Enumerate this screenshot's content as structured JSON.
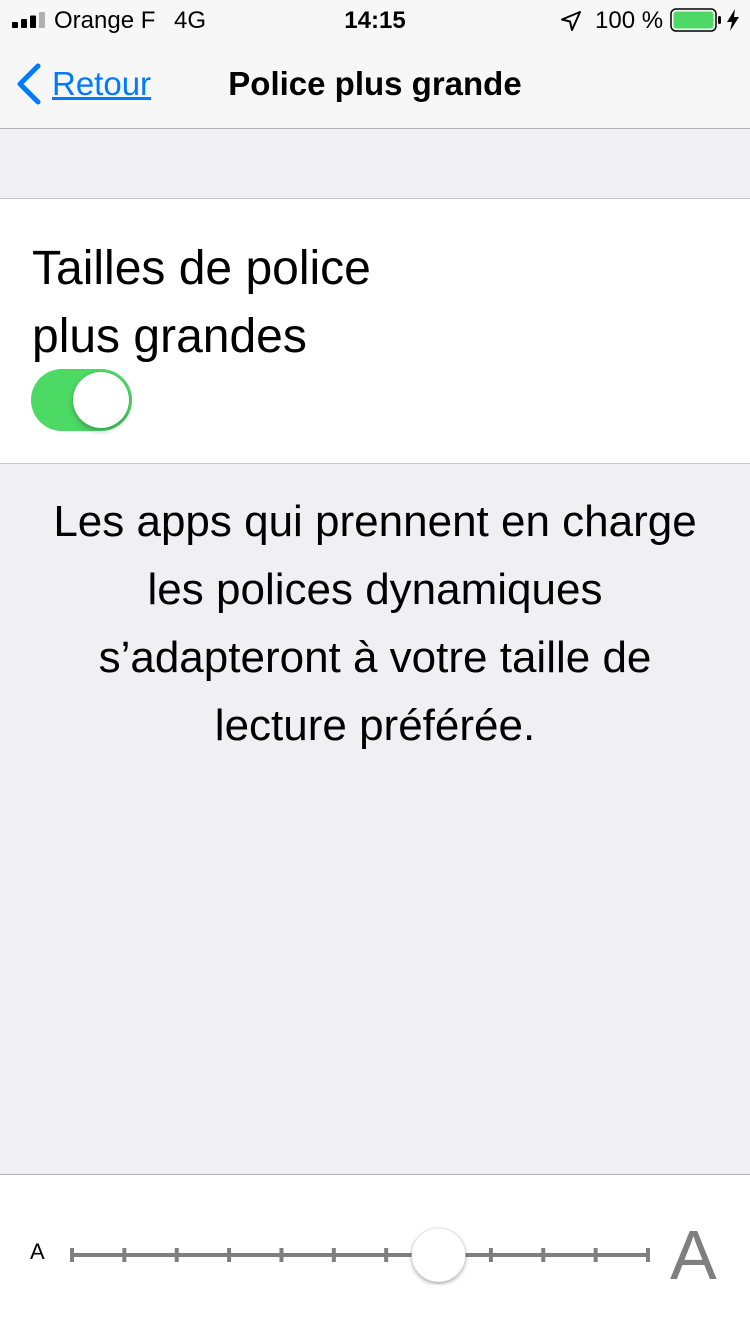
{
  "status_bar": {
    "carrier": "Orange F",
    "network": "4G",
    "time": "14:15",
    "battery_percent": "100 %",
    "icons": [
      "signal-icon",
      "location-icon",
      "battery-icon",
      "charging-icon"
    ],
    "battery_color": "#4cd964"
  },
  "nav": {
    "back_label": "Retour",
    "title": "Police plus grande"
  },
  "toggle_cell": {
    "label": "Tailles de police plus grandes",
    "toggle_on": true,
    "toggle_color": "#4cd964"
  },
  "description": "Les apps qui prennent en charge les polices dynamiques s’adapteront à votre taille de lecture préférée.",
  "slider": {
    "small_label": "A",
    "large_label": "A",
    "steps": 12,
    "selected_step": 7
  },
  "colors": {
    "accent": "#007aff",
    "background": "#efeff4"
  }
}
